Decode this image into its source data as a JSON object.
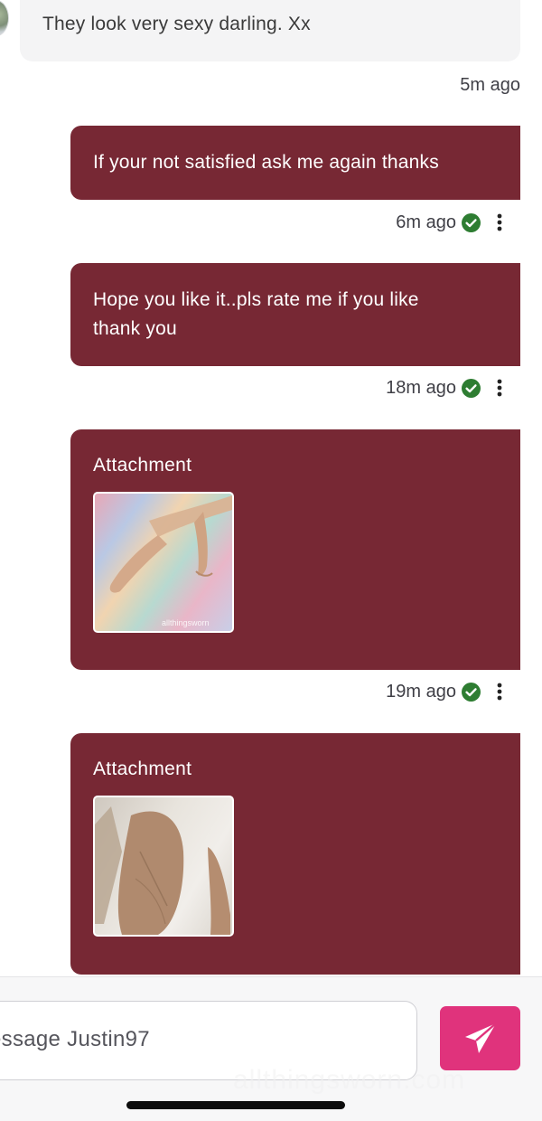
{
  "incoming": {
    "text": "They look very sexy darling. Xx",
    "timestamp": "5m ago"
  },
  "messages": [
    {
      "text": "If your not satisfied ask me again thanks",
      "timestamp": "6m ago"
    },
    {
      "text_line1": "Hope you like it..pls rate me if you like",
      "text_line2": "thank you",
      "timestamp": "18m ago"
    },
    {
      "attachment_label": "Attachment",
      "timestamp": "19m ago"
    },
    {
      "attachment_label": "Attachment"
    }
  ],
  "composer": {
    "placeholder_visible": "essage Justin97"
  },
  "watermark": "allthingsworn.com",
  "colors": {
    "bubble_out": "#772834",
    "bubble_in": "#f4f4f5",
    "send_button": "#e0337c",
    "check": "#2e7d32"
  },
  "icons": {
    "status": "check-circle-icon",
    "menu": "more-vertical-icon",
    "send": "paper-plane-icon"
  }
}
